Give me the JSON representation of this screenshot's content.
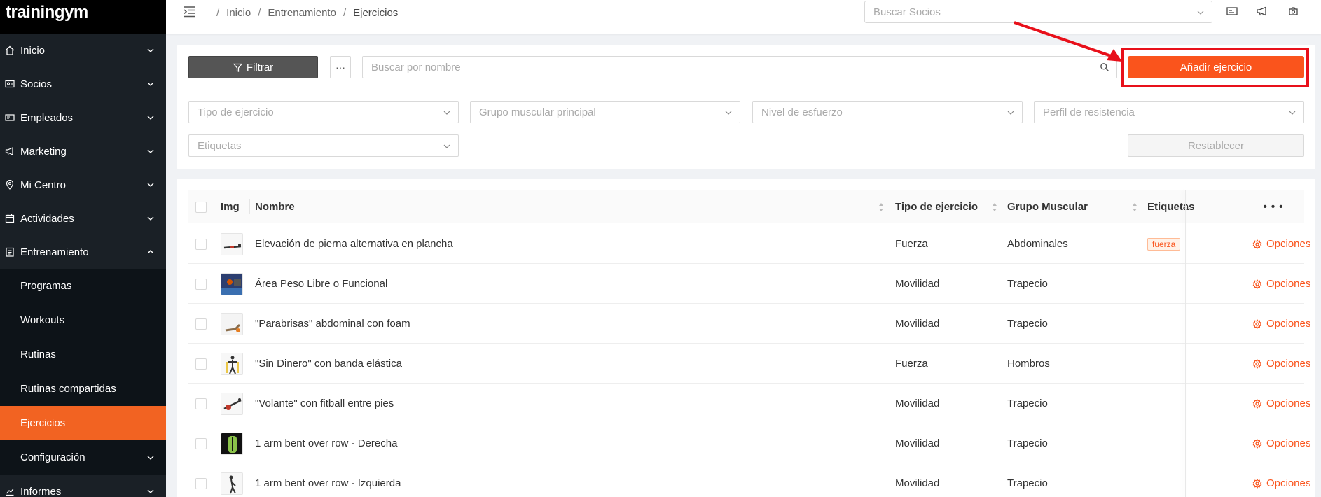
{
  "app": {
    "logo": "trainingym"
  },
  "sidebar": {
    "items": [
      {
        "label": "Inicio",
        "icon": "home-icon"
      },
      {
        "label": "Socios",
        "icon": "id-card-icon"
      },
      {
        "label": "Empleados",
        "icon": "badge-icon"
      },
      {
        "label": "Marketing",
        "icon": "megaphone-icon"
      },
      {
        "label": "Mi Centro",
        "icon": "location-icon"
      },
      {
        "label": "Actividades",
        "icon": "calendar-icon"
      },
      {
        "label": "Entrenamiento",
        "icon": "clipboard-icon"
      }
    ],
    "submenu": [
      {
        "label": "Programas"
      },
      {
        "label": "Workouts"
      },
      {
        "label": "Rutinas"
      },
      {
        "label": "Rutinas compartidas"
      },
      {
        "label": "Ejercicios"
      },
      {
        "label": "Configuración"
      }
    ],
    "last_item": {
      "label": "Informes",
      "icon": "chart-icon"
    }
  },
  "header": {
    "breadcrumb": [
      "Inicio",
      "Entrenamiento",
      "Ejercicios"
    ],
    "search_placeholder": "Buscar Socios"
  },
  "filters": {
    "filter_label": "Filtrar",
    "more_label": "···",
    "search_placeholder": "Buscar por nombre",
    "add_label": "Añadir ejercicio",
    "selects": [
      "Tipo de ejercicio",
      "Grupo muscular principal",
      "Nivel de esfuerzo",
      "Perfil de resistencia",
      "Etiquetas"
    ],
    "reset_label": "Restablecer"
  },
  "table": {
    "columns": [
      "Img",
      "Nombre",
      "Tipo de ejercicio",
      "Grupo Muscular",
      "Etiquetas",
      "• • •"
    ],
    "rows": [
      {
        "nombre": "Elevación de pierna alternativa en plancha",
        "tipo": "Fuerza",
        "grupo": "Abdominales",
        "tag": "fuerza",
        "opciones": "Opciones"
      },
      {
        "nombre": "Área Peso Libre o Funcional",
        "tipo": "Movilidad",
        "grupo": "Trapecio",
        "tag": "",
        "opciones": "Opciones"
      },
      {
        "nombre": "\"Parabrisas\" abdominal con foam",
        "tipo": "Movilidad",
        "grupo": "Trapecio",
        "tag": "",
        "opciones": "Opciones"
      },
      {
        "nombre": "\"Sin Dinero\" con banda elástica",
        "tipo": "Fuerza",
        "grupo": "Hombros",
        "tag": "",
        "opciones": "Opciones"
      },
      {
        "nombre": "\"Volante\" con fitball entre pies",
        "tipo": "Movilidad",
        "grupo": "Trapecio",
        "tag": "",
        "opciones": "Opciones"
      },
      {
        "nombre": "1 arm bent over row  - Derecha",
        "tipo": "Movilidad",
        "grupo": "Trapecio",
        "tag": "",
        "opciones": "Opciones"
      },
      {
        "nombre": "1 arm bent over row  - Izquierda",
        "tipo": "Movilidad",
        "grupo": "Trapecio",
        "tag": "",
        "opciones": "Opciones"
      }
    ]
  },
  "colors": {
    "accent": "#fa541c",
    "sidebar": "#1a2026",
    "highlight": "#e8101a"
  }
}
